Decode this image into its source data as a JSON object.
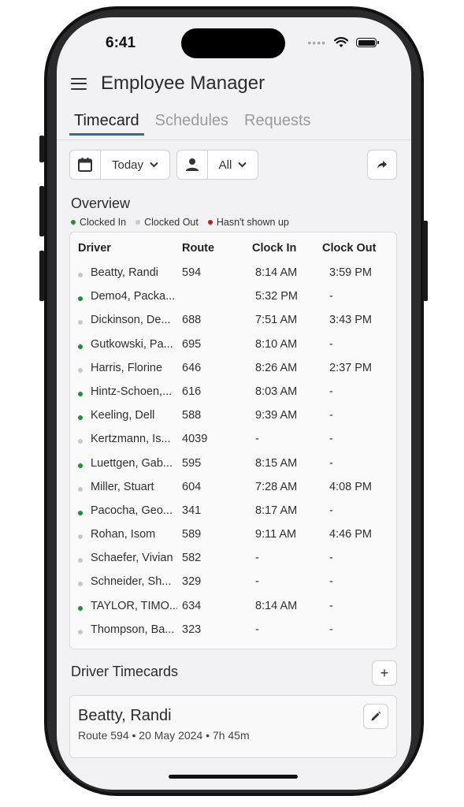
{
  "status": {
    "time": "6:41",
    "signal_dots": "••••"
  },
  "header": {
    "title": "Employee Manager"
  },
  "tabs": [
    {
      "label": "Timecard",
      "active": true
    },
    {
      "label": "Schedules",
      "active": false
    },
    {
      "label": "Requests",
      "active": false
    }
  ],
  "filters": {
    "date_label": "Today",
    "driver_label": "All"
  },
  "overview": {
    "title": "Overview",
    "legend": [
      {
        "label": "Clocked In",
        "color": "#1f8f3a"
      },
      {
        "label": "Clocked Out",
        "color": "#c8c8cc"
      },
      {
        "label": "Hasn't shown up",
        "color": "#c0191f"
      }
    ],
    "columns": [
      "Driver",
      "Route",
      "Clock In",
      "Clock Out"
    ],
    "rows": [
      {
        "status": "out",
        "driver": "Beatty, Randi",
        "route": "594",
        "clock_in": "8:14 AM",
        "clock_out": "3:59 PM"
      },
      {
        "status": "in",
        "driver": "Demo4, Packa...",
        "route": "",
        "clock_in": "5:32 PM",
        "clock_out": "-"
      },
      {
        "status": "out",
        "driver": "Dickinson, De...",
        "route": "688",
        "clock_in": "7:51 AM",
        "clock_out": "3:43 PM"
      },
      {
        "status": "in",
        "driver": "Gutkowski, Pa...",
        "route": "695",
        "clock_in": "8:10 AM",
        "clock_out": "-"
      },
      {
        "status": "out",
        "driver": "Harris, Florine",
        "route": "646",
        "clock_in": "8:26 AM",
        "clock_out": "2:37 PM"
      },
      {
        "status": "in",
        "driver": "Hintz-Schoen,...",
        "route": "616",
        "clock_in": "8:03 AM",
        "clock_out": "-"
      },
      {
        "status": "in",
        "driver": "Keeling, Dell",
        "route": "588",
        "clock_in": "9:39 AM",
        "clock_out": "-"
      },
      {
        "status": "out",
        "driver": "Kertzmann, Is...",
        "route": "4039",
        "clock_in": "-",
        "clock_out": "-"
      },
      {
        "status": "in",
        "driver": "Luettgen, Gab...",
        "route": "595",
        "clock_in": "8:15 AM",
        "clock_out": "-"
      },
      {
        "status": "out",
        "driver": "Miller, Stuart",
        "route": "604",
        "clock_in": "7:28 AM",
        "clock_out": "4:08 PM"
      },
      {
        "status": "in",
        "driver": "Pacocha, Geo...",
        "route": "341",
        "clock_in": "8:17 AM",
        "clock_out": "-"
      },
      {
        "status": "out",
        "driver": "Rohan, Isom",
        "route": "589",
        "clock_in": "9:11 AM",
        "clock_out": "4:46 PM"
      },
      {
        "status": "out",
        "driver": "Schaefer, Vivian",
        "route": "582",
        "clock_in": "-",
        "clock_out": "-"
      },
      {
        "status": "out",
        "driver": "Schneider, Sh...",
        "route": "329",
        "clock_in": "-",
        "clock_out": "-"
      },
      {
        "status": "in",
        "driver": "TAYLOR, TIMO...",
        "route": "634",
        "clock_in": "8:14 AM",
        "clock_out": "-"
      },
      {
        "status": "out",
        "driver": "Thompson, Ba...",
        "route": "323",
        "clock_in": "-",
        "clock_out": "-"
      }
    ]
  },
  "driver_timecards": {
    "title": "Driver Timecards",
    "add_label": "+",
    "card": {
      "name": "Beatty, Randi",
      "meta": "Route 594 •  20 May 2024 • 7h 45m"
    }
  },
  "colors": {
    "accent": "#2b6f9a",
    "clocked_in": "#1f8f3a",
    "clocked_out": "#c8c8cc",
    "no_show": "#c0191f"
  }
}
